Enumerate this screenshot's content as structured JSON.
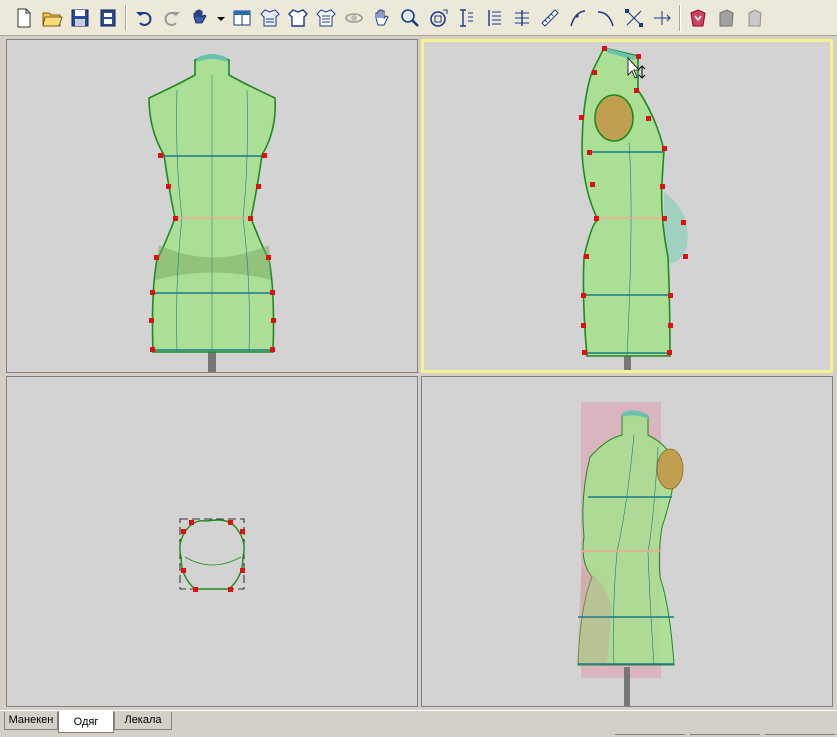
{
  "toolbar": {
    "buttons": [
      {
        "name": "new-file-icon"
      },
      {
        "name": "open-folder-icon"
      },
      {
        "name": "save-icon"
      },
      {
        "name": "print-icon"
      },
      {
        "name": "undo-icon"
      },
      {
        "name": "redo-icon"
      },
      {
        "name": "hand-menu-icon"
      },
      {
        "name": "dropdown-arrow-icon"
      },
      {
        "name": "layout-icon"
      },
      {
        "name": "garment-edit-icon"
      },
      {
        "name": "shirt-icon"
      },
      {
        "name": "shirt-measure-icon"
      },
      {
        "name": "rotate-icon"
      },
      {
        "name": "pan-hand-icon"
      },
      {
        "name": "zoom-icon"
      },
      {
        "name": "zoom-extents-icon"
      },
      {
        "name": "vertical-dimension-icon"
      },
      {
        "name": "vertical-dimension-2-icon"
      },
      {
        "name": "vertical-dimension-3-icon"
      },
      {
        "name": "ruler-icon"
      },
      {
        "name": "curve-point-icon"
      },
      {
        "name": "curve-icon"
      },
      {
        "name": "scale-points-icon"
      },
      {
        "name": "move-point-icon"
      },
      {
        "name": "render-shaded-icon"
      },
      {
        "name": "render-gray-icon"
      },
      {
        "name": "render-light-icon"
      }
    ]
  },
  "tabs": [
    {
      "label": "Манекен",
      "active": false
    },
    {
      "label": "Одяг",
      "active": true
    },
    {
      "label": "Лекала",
      "active": false
    }
  ],
  "colors": {
    "body_fill": "#a6e08e",
    "body_stroke": "#1f8a1f",
    "guide_line": "#1a7a8a",
    "waist_line": "#f0a890",
    "control_point": "#e01010",
    "selected_border": "#f6f28f",
    "viewport_bg": "#d3d3d3"
  }
}
